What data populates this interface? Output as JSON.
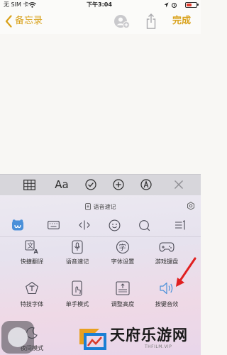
{
  "status_bar": {
    "carrier": "无 SIM 卡",
    "time": "下午3:04",
    "battery_level": 0.55,
    "battery_color": "#e03b2e"
  },
  "nav": {
    "back_label": "备忘录",
    "done_label": "完成",
    "accent_color": "#d9a21b",
    "icons": [
      "add-person-icon",
      "share-icon"
    ]
  },
  "format_toolbar": {
    "text_style_label": "Aa",
    "icons": [
      "table-icon",
      "text-style-icon",
      "checklist-icon",
      "add-icon",
      "markup-icon",
      "close-icon"
    ]
  },
  "keyboard": {
    "voice_memo_label": "语音速记",
    "tabs": [
      "keyboard-logo-icon",
      "keyboard-icon",
      "cursor-icon",
      "emoji-icon",
      "search-icon",
      "menu-icon"
    ],
    "grid": [
      {
        "label": "快捷翻译",
        "icon": "translate-icon"
      },
      {
        "label": "语音速记",
        "icon": "voice-memo-icon"
      },
      {
        "label": "字体设置",
        "icon": "font-settings-icon"
      },
      {
        "label": "游戏键盘",
        "icon": "gamepad-icon"
      },
      {
        "label": "特技字体",
        "icon": "special-font-icon"
      },
      {
        "label": "单手模式",
        "icon": "one-hand-icon"
      },
      {
        "label": "调整高度",
        "icon": "adjust-height-icon"
      },
      {
        "label": "按键音效",
        "icon": "key-sound-icon"
      },
      {
        "label": "夜间模式",
        "icon": "night-mode-icon"
      }
    ]
  },
  "watermark": {
    "title": "天府乐游网",
    "subtitle": "THFILM.VIP"
  }
}
